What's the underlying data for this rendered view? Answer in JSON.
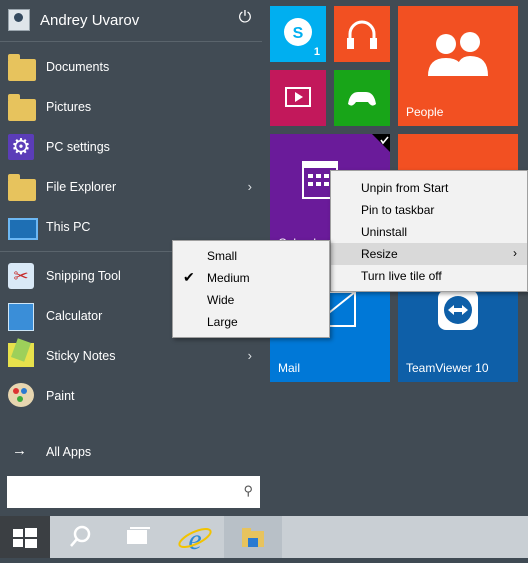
{
  "user": {
    "name": "Andrey Uvarov"
  },
  "places": [
    {
      "label": "Documents",
      "icon": "documents-folder-icon"
    },
    {
      "label": "Pictures",
      "icon": "pictures-folder-icon"
    },
    {
      "label": "PC settings",
      "icon": "gear-icon"
    },
    {
      "label": "File Explorer",
      "icon": "file-explorer-icon",
      "has_submenu": true
    },
    {
      "label": "This PC",
      "icon": "computer-icon"
    }
  ],
  "apps": [
    {
      "label": "Snipping Tool",
      "icon": "scissors-icon"
    },
    {
      "label": "Calculator",
      "icon": "calculator-icon"
    },
    {
      "label": "Sticky Notes",
      "icon": "sticky-notes-icon",
      "has_submenu": true
    },
    {
      "label": "Paint",
      "icon": "paint-palette-icon"
    }
  ],
  "all_apps": {
    "label": "All Apps"
  },
  "search": {
    "value": ""
  },
  "tiles": {
    "skype_badge": "1",
    "people": "People",
    "calendar_partial": "Calend",
    "mail": "Mail",
    "teamviewer": "TeamViewer 10"
  },
  "context_menu": {
    "items": [
      {
        "label": "Unpin from Start"
      },
      {
        "label": "Pin to taskbar"
      },
      {
        "label": "Uninstall"
      },
      {
        "label": "Resize",
        "has_submenu": true,
        "highlighted": true
      },
      {
        "label": "Turn live tile off"
      }
    ]
  },
  "resize_submenu": {
    "items": [
      {
        "label": "Small",
        "checked": false
      },
      {
        "label": "Medium",
        "checked": true
      },
      {
        "label": "Wide",
        "checked": false
      },
      {
        "label": "Large",
        "checked": false
      }
    ]
  },
  "colors": {
    "menu_bg": "#414b54",
    "skype": "#00aff0",
    "music": "#f25022",
    "people": "#f25022",
    "video": "#c2185b",
    "xbox": "#18a518",
    "calendar": "#6a1b9a",
    "mail": "#0078d7",
    "teamviewer": "#0e5fa8",
    "orange_tile": "#f25022"
  }
}
